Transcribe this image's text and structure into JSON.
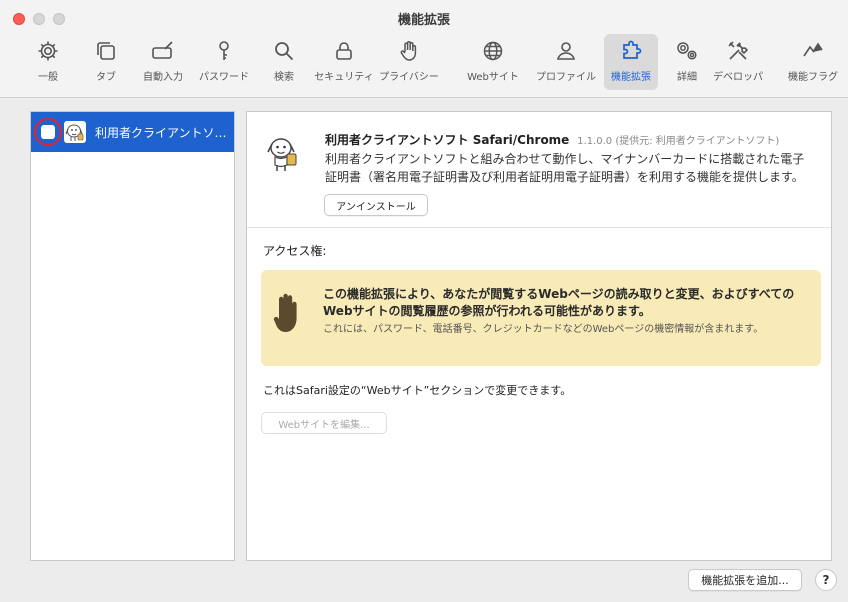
{
  "window": {
    "title": "機能拡張"
  },
  "toolbar": {
    "items": [
      {
        "label": "一般",
        "icon": "gear-icon"
      },
      {
        "label": "タブ",
        "icon": "tabs-icon"
      },
      {
        "label": "自動入力",
        "icon": "autofill-icon"
      },
      {
        "label": "パスワード",
        "icon": "key-icon"
      },
      {
        "label": "検索",
        "icon": "search-icon"
      },
      {
        "label": "セキュリティ",
        "icon": "lock-icon"
      },
      {
        "label": "プライバシー",
        "icon": "hand-icon"
      },
      {
        "label": "Webサイト",
        "icon": "globe-icon"
      },
      {
        "label": "プロファイル",
        "icon": "person-icon"
      },
      {
        "label": "機能拡張",
        "icon": "puzzle-icon",
        "selected": true
      },
      {
        "label": "詳細",
        "icon": "gears-icon"
      },
      {
        "label": "デベロッパ",
        "icon": "tools-icon"
      },
      {
        "label": "機能フラグ",
        "icon": "flags-icon"
      }
    ]
  },
  "extensions_list": [
    {
      "name": "利用者クライアントソフト Safari/Chrome",
      "enabled": false,
      "selected": true
    }
  ],
  "detail": {
    "name": "利用者クライアントソフト Safari/Chrome",
    "version_info": "1.1.0.0 (提供元: 利用者クライアントソフト)",
    "description": "利用者クライアントソフトと組み合わせて動作し、マイナンバーカードに搭載された電子証明書（署名用電子証明書及び利用者証明用電子証明書）を利用する機能を提供します。",
    "uninstall_label": "アンインストール",
    "access_label": "アクセス権:",
    "warning_strong": "この機能拡張により、あなたが閲覧するWebページの読み取りと変更、およびすべてのWebサイトの閲覧履歴の参照が行われる可能性があります。",
    "warning_sub": "これには、パスワード、電話番号、クレジットカードなどのWebページの機密情報が含まれます。",
    "settings_note": "これはSafari設定の“Webサイト”セクションで変更できます。",
    "edit_websites_label": "Webサイトを編集..."
  },
  "footer": {
    "add_extension_label": "機能拡張を追加...",
    "help_label": "?"
  },
  "colors": {
    "accent": "#1e62d0",
    "warning_bg": "#f8ebb7",
    "highlight_ring": "#e0242c"
  }
}
